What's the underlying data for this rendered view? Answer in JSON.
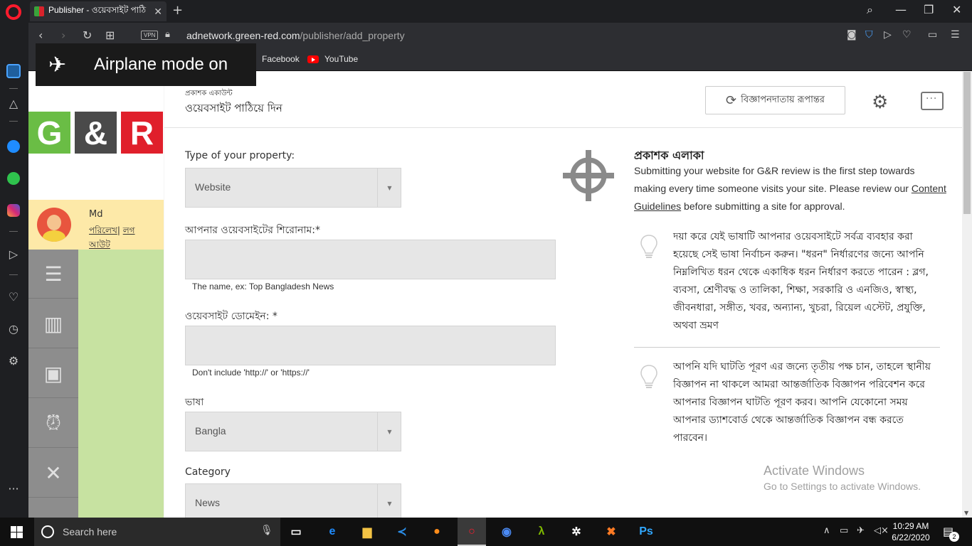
{
  "browser": {
    "tab_title": "Publisher - ওয়েবসাইট পাঠি",
    "url_host": "adnetwork.green-red.com",
    "url_path": "/publisher/add_property",
    "vpn_label": "VPN",
    "bookmarks": [
      "Facebook",
      "YouTube"
    ]
  },
  "toast": {
    "text": "Airplane mode on"
  },
  "logo": {
    "letters": [
      "G",
      "&",
      "R"
    ],
    "colors": [
      "#6abd45",
      "#4a4a4a",
      "#e01f2b"
    ]
  },
  "user": {
    "name": "Md",
    "profile_link": "পরিলেখ",
    "sep": "|",
    "logout_link": "লগ আউট"
  },
  "header": {
    "crumb": "প্রকাশক একাউন্ট",
    "title": "ওয়েবসাইট পাঠিয়ে দিন",
    "switch_button": "বিজ্ঞাপনদাতায় রূপান্তর"
  },
  "form": {
    "property_type_label": "Type of your property:",
    "property_type_value": "Website",
    "site_title_label": "আপনার ওয়েবসাইটের শিরোনাম:*",
    "site_title_hint": "The name, ex: Top Bangladesh News",
    "domain_label": "ওয়েবসাইট ডোমেইন: *",
    "domain_hint": "Don't include 'http://' or 'https://'",
    "language_label": "ভাষা",
    "language_value": "Bangla",
    "category_label": "Category",
    "category_value": "News"
  },
  "info": {
    "title": "প্রকাশক এলাকা",
    "desc_before": "Submitting your website for G&R review is the first step towards making every time someone visits your site. Please review our ",
    "desc_link": "Content Guidelines",
    "desc_after": " before submitting a site for approval.",
    "tip1": "দয়া করে যেই ভাষাটি আপনার ওয়েবসাইটে সর্বত্র ব্যবহার করা হয়েছে সেই ভাষা নির্বাচন করুন। \"ধরন\" নির্ধারণের জন্যে আপনি নিম্নলিখিত ধরন থেকে একাধিক ধরন নির্ধারণ করতে পারেন : ব্লগ, ব্যবসা, শ্রেণীবদ্ধ ও তালিকা, শিক্ষা, সরকারি ও এনজিও, স্বাস্থ্য, জীবনধারা, সঙ্গীত, খবর, অন্যান্য, খুচরা, রিয়েল এস্টেট, প্রযুক্তি, অথবা ভ্রমণ",
    "tip2": "আপনি যদি ঘাটতি পূরণ এর জন্যে তৃতীয় পক্ষ চান, তাহলে স্থানীয় বিজ্ঞাপন না থাকলে আমরা আন্তর্জাতিক বিজ্ঞাপন পরিবেশন করে আপনার বিজ্ঞাপন ঘাটতি পূরণ করব। আপনি যেকোনো সময় আপনার ড্যাশবোর্ড থেকে আন্তর্জাতিক বিজ্ঞাপন বন্ধ করতে পারবেন।"
  },
  "watermark": {
    "line1": "Activate Windows",
    "line2": "Go to Settings to activate Windows."
  },
  "taskbar": {
    "search_placeholder": "Search here",
    "time": "10:29 AM",
    "date": "6/22/2020",
    "notif_count": "2"
  }
}
